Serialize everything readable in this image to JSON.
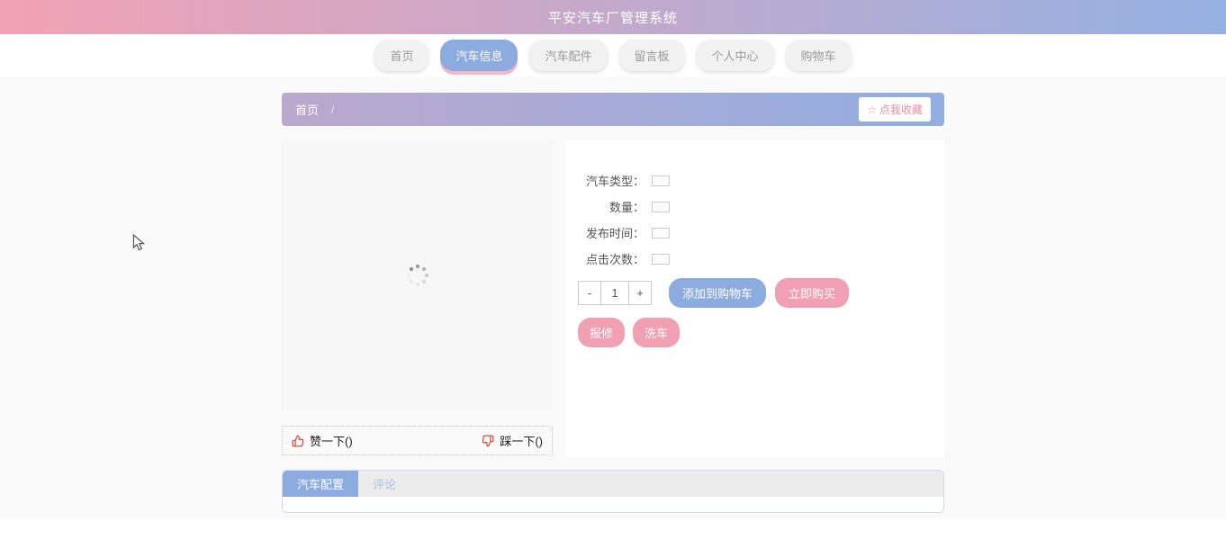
{
  "header": {
    "title": "平安汽车厂管理系统"
  },
  "nav": {
    "items": [
      {
        "label": "首页",
        "active": false
      },
      {
        "label": "汽车信息",
        "active": true
      },
      {
        "label": "汽车配件",
        "active": false
      },
      {
        "label": "留言板",
        "active": false
      },
      {
        "label": "个人中心",
        "active": false
      },
      {
        "label": "购物车",
        "active": false
      }
    ]
  },
  "breadcrumb": {
    "home": "首页",
    "separator": "/",
    "collect": {
      "icon": "☆",
      "label": "点我收藏"
    }
  },
  "product": {
    "fields": [
      {
        "label": "汽车类型：",
        "value": ""
      },
      {
        "label": "数量：",
        "value": ""
      },
      {
        "label": "发布时间：",
        "value": ""
      },
      {
        "label": "点击次数：",
        "value": ""
      }
    ],
    "quantity": {
      "decrease": "-",
      "value": "1",
      "increase": "+"
    },
    "actions": {
      "add_to_cart": "添加到购物车",
      "buy_now": "立即购买",
      "repair": "报修",
      "wash": "洗车"
    },
    "feedback": {
      "like": "赞一下()",
      "dislike": "踩一下()"
    }
  },
  "detail_tabs": {
    "items": [
      {
        "label": "汽车配置",
        "active": true
      },
      {
        "label": "评论",
        "active": false
      }
    ]
  },
  "colors": {
    "header_gradient_start": "#f2a2b4",
    "header_gradient_end": "#94b1e2",
    "breadcrumb_gradient_start": "#bba8cd",
    "breadcrumb_gradient_end": "#92aee1",
    "accent_blue": "#8cacdf",
    "accent_pink": "#f19fb2",
    "active_tab_shadow_pink": "#f3b7c6",
    "collect_text_pink": "#ee8ba6",
    "icon_red": "#e23a2e",
    "page_background": "#fafafa"
  }
}
